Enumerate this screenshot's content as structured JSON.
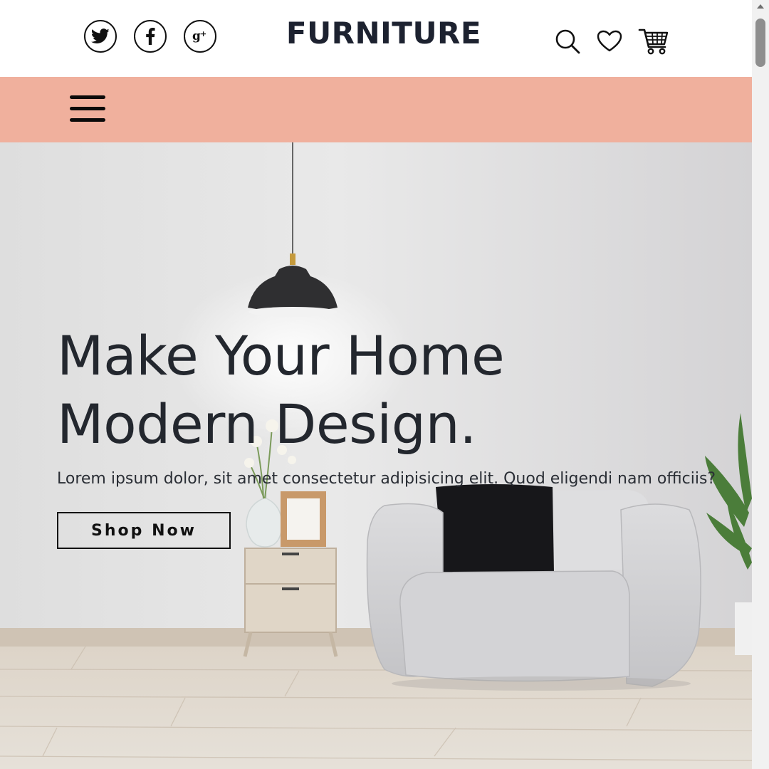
{
  "header": {
    "brand": "FURNITURE",
    "social": [
      {
        "name": "twitter",
        "icon": "twitter-icon"
      },
      {
        "name": "facebook",
        "icon": "facebook-icon"
      },
      {
        "name": "google-plus",
        "icon": "google-plus-icon"
      }
    ],
    "actions": [
      {
        "name": "search",
        "icon": "search-icon"
      },
      {
        "name": "wishlist",
        "icon": "heart-icon"
      },
      {
        "name": "cart",
        "icon": "cart-icon"
      }
    ],
    "menu_icon": "hamburger-menu-icon",
    "menubar_color": "#f0b09d"
  },
  "hero": {
    "title_line1": "Make Your Home",
    "title_line2": "Modern Design.",
    "text": "Lorem ipsum dolor, sit amet consectetur adipisicing elit. Quod eligendi nam officiis?",
    "button": "Shop Now"
  },
  "colors": {
    "accent": "#f0b09d",
    "text_dark": "#23272e"
  }
}
